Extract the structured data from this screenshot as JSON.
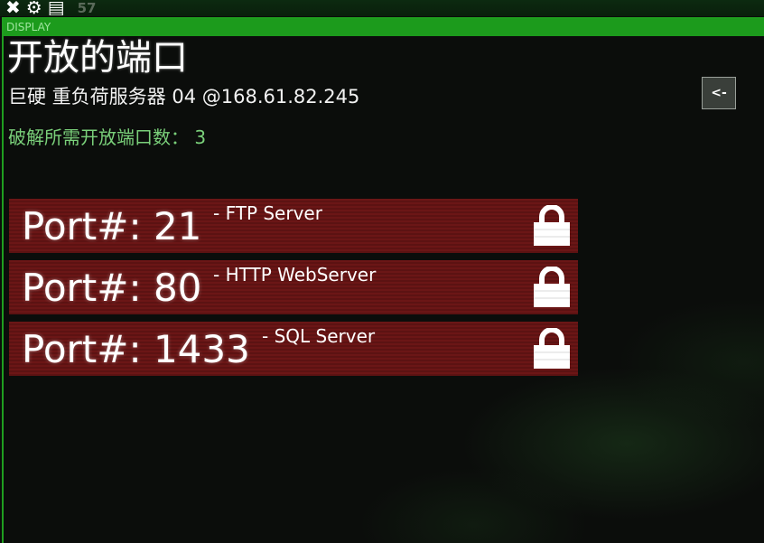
{
  "topbar": {
    "icons": [
      "close-icon",
      "gear-icon",
      "notes-icon"
    ],
    "close_glyph": "✖",
    "gear_glyph": "⚙",
    "notes_glyph": "▤",
    "count": "57"
  },
  "panel": {
    "header_label": "DISPLAY",
    "title": "开放的端口",
    "subtitle": "巨硬 重负荷服务器 04 @168.61.82.245",
    "required_label": "破解所需开放端口数：",
    "required_count": "3",
    "back_label": "<-"
  },
  "ports": [
    {
      "label": "Port#: 21",
      "desc": "- FTP Server",
      "locked": true
    },
    {
      "label": "Port#: 80",
      "desc": "- HTTP WebServer",
      "locked": true
    },
    {
      "label": "Port#: 1433",
      "desc": "- SQL Server",
      "locked": true
    }
  ],
  "colors": {
    "accent_green": "#1f9e1f",
    "required_text": "#7ad07a",
    "port_row": "#6b1616"
  }
}
